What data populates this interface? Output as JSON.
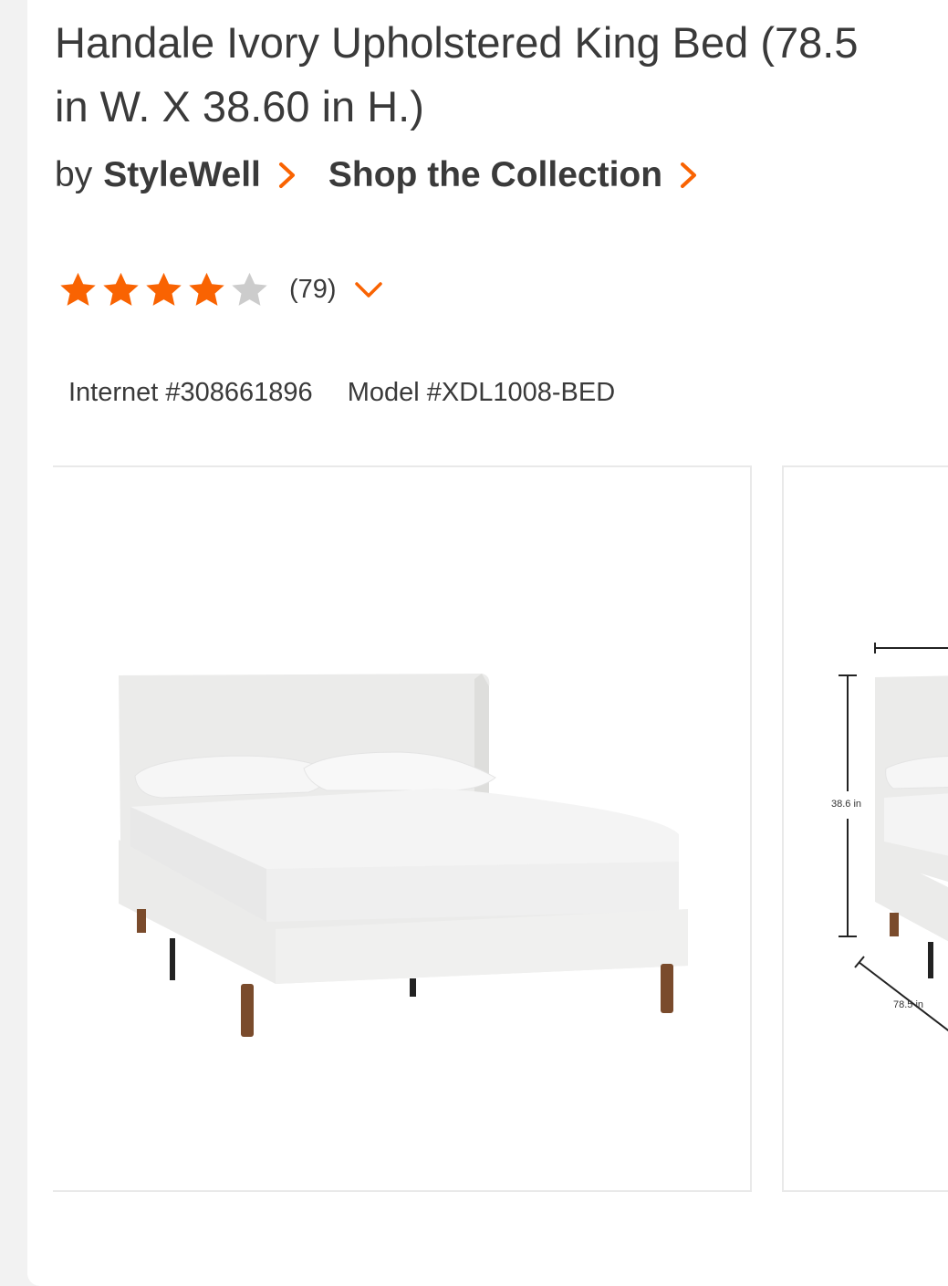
{
  "product": {
    "title_line1": "Handale Ivory Upholstered King Bed (78.5",
    "title_line2": "in W. X 38.60 in H.)",
    "by_label": "by",
    "brand": "StyleWell",
    "collection_link": "Shop the Collection"
  },
  "rating": {
    "stars_filled": 4,
    "stars_total": 5,
    "review_count": "(79)"
  },
  "identifiers": {
    "internet": "Internet #308661896",
    "model": "Model #XDL1008-BED"
  },
  "gallery": {
    "dimension_height": "38.6 in",
    "dimension_width": "78.5 in"
  },
  "colors": {
    "accent": "#f96302",
    "star_filled": "#f96302",
    "star_empty": "#cccccc",
    "text": "#3a3a3a"
  },
  "icons": [
    "chevron-right-icon",
    "star-icon",
    "chevron-down-icon"
  ]
}
